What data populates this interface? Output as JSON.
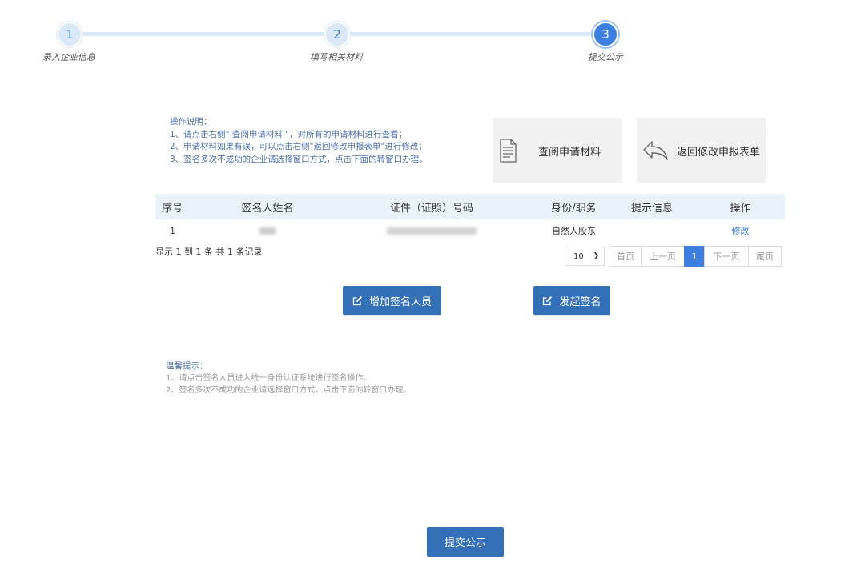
{
  "stepper": {
    "steps": [
      {
        "number": "1",
        "label": "录入企业信息"
      },
      {
        "number": "2",
        "label": "填写相关材料"
      },
      {
        "number": "3",
        "label": "提交公示"
      }
    ],
    "active_step": 3
  },
  "instructions": {
    "title": "操作说明：",
    "lines": [
      "1、请点击右侧\" 查阅申请材料 \"，对所有的申请材料进行查看；",
      "2、申请材料如果有误，可以点击右侧\"返回修改申报表单\"进行修改；",
      "3、签名多次不成功的企业请选择窗口方式，点击下面的转窗口办理。"
    ]
  },
  "cards": {
    "view_materials": {
      "label": "查阅申请材料",
      "icon": "document-icon"
    },
    "back_edit": {
      "label": "返回修改申报表单",
      "icon": "reply-arrow-icon"
    }
  },
  "table": {
    "headers": {
      "no": "序号",
      "name": "签名人姓名",
      "id": "证件（证照）号码",
      "role": "身份/职务",
      "tip": "提示信息",
      "op": "操作"
    },
    "rows": [
      {
        "no": "1",
        "role": "自然人股东",
        "tip": "",
        "op": "修改"
      }
    ]
  },
  "record_info": "显示 1 到 1 条 共 1 条记录",
  "pagination": {
    "page_size": "10",
    "first": "首页",
    "prev": "上一页",
    "current": "1",
    "next": "下一页",
    "last": "尾页"
  },
  "buttons": {
    "add_signer": "增加签名人员",
    "start_sign": "发起签名",
    "submit": "提交公示"
  },
  "tips": {
    "title": "温馨提示：",
    "lines": [
      "1、请点击签名人员进入统一身份认证系统进行签名操作。",
      "2、签名多次不成功的企业请选择窗口方式，点击下面的转窗口办理。"
    ]
  },
  "colors": {
    "primary": "#3470b8",
    "active_step": "#3d7fe0",
    "header_bg": "#e9f1fb",
    "card_bg": "#f1f1f1"
  }
}
